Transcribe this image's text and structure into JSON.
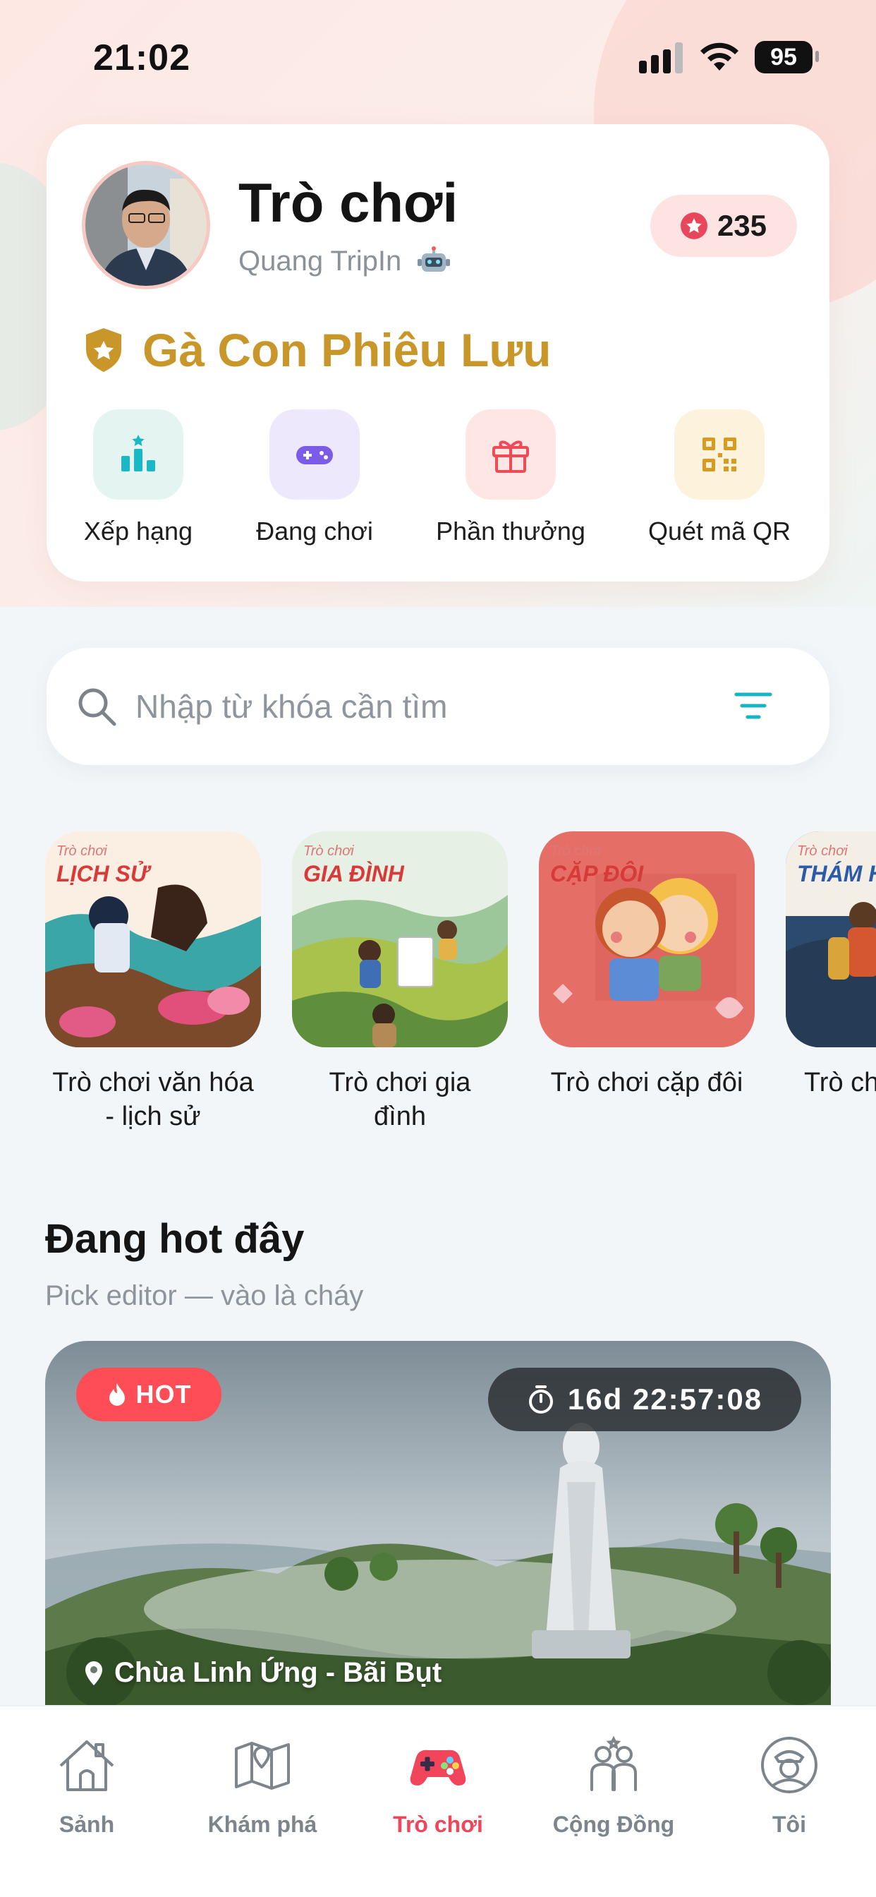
{
  "status_bar": {
    "time": "21:02",
    "battery": "95"
  },
  "profile": {
    "title": "Trò chơi",
    "username": "Quang TripIn",
    "points": "235",
    "rank_name": "Gà Con Phiêu Lưu"
  },
  "quick_actions": [
    {
      "label": "Xếp hạng",
      "icon": "leaderboard-icon",
      "color": "#e4f4f1"
    },
    {
      "label": "Đang chơi",
      "icon": "gamepad-icon",
      "color": "#ede8fb"
    },
    {
      "label": "Phần thưởng",
      "icon": "gift-icon",
      "color": "#fde6e3"
    },
    {
      "label": "Quét mã QR",
      "icon": "qr-code-icon",
      "color": "#fdf3dc"
    }
  ],
  "search": {
    "placeholder": "Nhập từ khóa cần tìm"
  },
  "categories": [
    {
      "tag_small": "Trò chơi",
      "tag": "LỊCH SỬ",
      "label_line1": "Trò chơi văn hóa",
      "label_line2": "- lịch sử"
    },
    {
      "tag_small": "Trò chơi",
      "tag": "GIA ĐÌNH",
      "label_line1": "Trò chơi gia",
      "label_line2": "đình"
    },
    {
      "tag_small": "Trò chơi",
      "tag": "CẶP ĐÔI",
      "label_line1": "Trò chơi cặp đôi",
      "label_line2": ""
    },
    {
      "tag_small": "Trò chơi",
      "tag": "THÁM HI",
      "label_line1": "Trò ch",
      "label_line2": "h"
    }
  ],
  "hot_section": {
    "title": "Đang hot đây",
    "subtitle": "Pick editor — vào là cháy",
    "badge": "HOT",
    "countdown": "16d 22:57:08",
    "location": "Chùa Linh Ứng - Bãi Bụt"
  },
  "tab_bar": [
    {
      "label": "Sảnh",
      "icon": "home-icon"
    },
    {
      "label": "Khám phá",
      "icon": "map-icon"
    },
    {
      "label": "Trò chơi",
      "icon": "game-controller-icon",
      "active": true
    },
    {
      "label": "Cộng Đồng",
      "icon": "community-icon"
    },
    {
      "label": "Tôi",
      "icon": "profile-icon"
    }
  ],
  "colors": {
    "accent": "#f0455a",
    "rank_gold": "#c9962a",
    "teal": "#19b3c6"
  }
}
